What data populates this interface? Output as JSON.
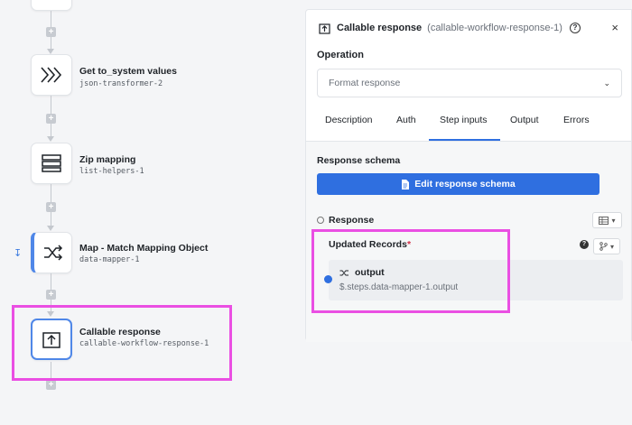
{
  "workflow": {
    "nodes": [
      {
        "title": "Get to_system values",
        "subtitle": "json-transformer-2",
        "icon": "triple-chevron-icon"
      },
      {
        "title": "Zip mapping",
        "subtitle": "list-helpers-1",
        "icon": "list-icon"
      },
      {
        "title": "Map - Match Mapping Object",
        "subtitle": "data-mapper-1",
        "icon": "shuffle-icon"
      },
      {
        "title": "Callable response",
        "subtitle": "callable-workflow-response-1",
        "icon": "upload-box-icon"
      }
    ],
    "plus_label": "+",
    "collapse_icon_glyph": "↧"
  },
  "panel": {
    "title": "Callable response",
    "id": "(callable-workflow-response-1)",
    "help_glyph": "?",
    "close_glyph": "×",
    "operation_label": "Operation",
    "operation_value": "Format response",
    "tabs": [
      "Description",
      "Auth",
      "Step inputs",
      "Output",
      "Errors"
    ],
    "active_tab": "Step inputs",
    "response_schema_label": "Response schema",
    "edit_button_label": "Edit response schema",
    "response_label": "Response",
    "updated_records_label": "Updated Records",
    "required_mark": "*",
    "info_glyph": "?",
    "output": {
      "name": "output",
      "path": "$.steps.data-mapper-1.output"
    }
  },
  "colors": {
    "accent": "#2f6fe0",
    "highlight": "#ea4fe3"
  }
}
